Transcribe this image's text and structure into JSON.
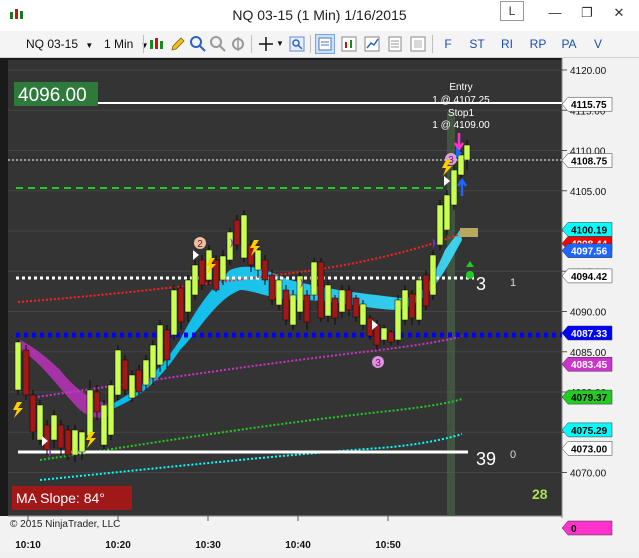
{
  "window": {
    "title": "NQ 03-15 (1 Min)  1/16/2015",
    "layout_button": "L",
    "minimize_glyph": "—",
    "restore_glyph": "❐",
    "close_glyph": "✕"
  },
  "toolbar": {
    "instrument": "NQ 03-15",
    "interval": "1 Min",
    "letters": [
      "F",
      "ST",
      "RI",
      "RP",
      "PA",
      "V"
    ]
  },
  "chart": {
    "price_box": "4096.00",
    "entry_label": "Entry",
    "entry_detail": "1 @ 4107.25",
    "stop_label": "Stop1",
    "stop_detail": "1 @ 4109.00",
    "ma_slope": "MA Slope:  84°",
    "label_3": "3",
    "label_1": "1",
    "label_39": "39",
    "label_0": "0",
    "label_28": "28",
    "copyright": "© 2015 NinjaTrader, LLC",
    "marker_2": "2",
    "marker_3a": "3",
    "marker_3b": "3",
    "price_axis": [
      "4120.00",
      "4115.00",
      "4110.00",
      "4105.00",
      "4100.00",
      "4095.00",
      "4090.00",
      "4085.00",
      "4080.00",
      "4075.00",
      "4070.00"
    ],
    "tags": [
      {
        "text": "4115.75",
        "bg": "#ffffff",
        "fg": "#000000"
      },
      {
        "text": "4108.75",
        "bg": "#ffffff",
        "fg": "#000000"
      },
      {
        "text": "4100.19",
        "bg": "#00ffff",
        "fg": "#000000"
      },
      {
        "text": "4098.44",
        "bg": "#ff0000",
        "fg": "#ffffff"
      },
      {
        "text": "4097.56",
        "bg": "#1e64ff",
        "fg": "#ffffff"
      },
      {
        "text": "4094.42",
        "bg": "#ffffff",
        "fg": "#000000"
      },
      {
        "text": "4087.33",
        "bg": "#0000ff",
        "fg": "#ffffff"
      },
      {
        "text": "4083.45",
        "bg": "#cc33cc",
        "fg": "#ffffff"
      },
      {
        "text": "4079.37",
        "bg": "#22cc22",
        "fg": "#000000"
      },
      {
        "text": "4075.29",
        "bg": "#00ffff",
        "fg": "#000000"
      },
      {
        "text": "4073.00",
        "bg": "#ffffff",
        "fg": "#000000"
      },
      {
        "text": "0",
        "bg": "#ff33cc",
        "fg": "#000000"
      }
    ],
    "time_axis": [
      "10:10",
      "10:20",
      "10:30",
      "10:40",
      "10:50"
    ],
    "colors": {
      "background": "#323232",
      "up_bar": "#c8ff50",
      "down_bar": "#a01818",
      "blue_line": "#0000ff",
      "red_line": "#ff2020",
      "green_line": "#22cc22",
      "cyan_line": "#00ffff",
      "magenta_line": "#cc33cc"
    }
  }
}
